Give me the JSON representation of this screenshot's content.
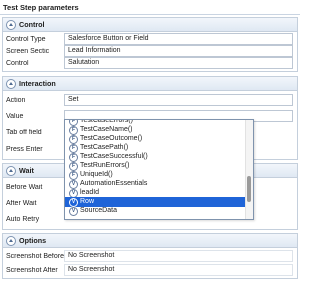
{
  "panel": {
    "title": "Test Step parameters"
  },
  "control": {
    "header": "Control",
    "rows": [
      {
        "label": "Control Type",
        "value": "Salesforce Button or Field"
      },
      {
        "label": "Screen Sectic",
        "value": "Lead Information"
      },
      {
        "label": "Control",
        "value": "Salutation"
      }
    ]
  },
  "interaction": {
    "header": "Interaction",
    "action": {
      "label": "Action",
      "value": "Set"
    },
    "value": {
      "label": "Value",
      "value": ""
    },
    "tab_off": {
      "label": "Tab off field"
    },
    "press_enter": {
      "label": "Press Enter"
    }
  },
  "wait": {
    "header": "Wait",
    "before": {
      "label": "Before Wait"
    },
    "after": {
      "label": "After Wait"
    },
    "retry": {
      "label": "Auto Retry"
    }
  },
  "options": {
    "header": "Options",
    "before": {
      "label": "Screenshot Before",
      "value": "No Screenshot"
    },
    "after": {
      "label": "Screenshot After",
      "value": "No Screenshot"
    }
  },
  "dropdown": {
    "selected_index": 9,
    "items": [
      {
        "icon": "F",
        "label": "TestCaseErrors()"
      },
      {
        "icon": "F",
        "label": "TestCaseName()"
      },
      {
        "icon": "F",
        "label": "TestCaseOutcome()"
      },
      {
        "icon": "F",
        "label": "TestCasePath()"
      },
      {
        "icon": "F",
        "label": "TestCaseSuccessful()"
      },
      {
        "icon": "F",
        "label": "TestRunErrors()"
      },
      {
        "icon": "F",
        "label": "UniqueId()"
      },
      {
        "icon": "V",
        "label": "AutomationEssentials"
      },
      {
        "icon": "V",
        "label": "leadId"
      },
      {
        "icon": "V",
        "label": "Row"
      },
      {
        "icon": "V",
        "label": "SourceData"
      }
    ]
  },
  "colors": {
    "selection": "#1f64d8",
    "header_bg": "#dfe8f3",
    "border": "#c4cfdc"
  }
}
